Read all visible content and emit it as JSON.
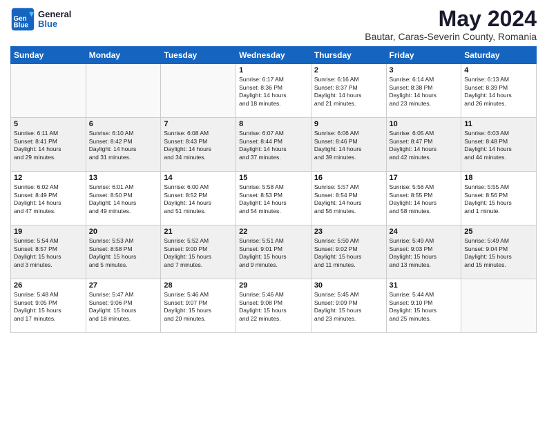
{
  "header": {
    "logo_line1": "General",
    "logo_line2": "Blue",
    "main_title": "May 2024",
    "subtitle": "Bautar, Caras-Severin County, Romania"
  },
  "days_of_week": [
    "Sunday",
    "Monday",
    "Tuesday",
    "Wednesday",
    "Thursday",
    "Friday",
    "Saturday"
  ],
  "weeks": [
    {
      "shade": "white",
      "days": [
        {
          "num": "",
          "info": ""
        },
        {
          "num": "",
          "info": ""
        },
        {
          "num": "",
          "info": ""
        },
        {
          "num": "1",
          "info": "Sunrise: 6:17 AM\nSunset: 8:36 PM\nDaylight: 14 hours\nand 18 minutes."
        },
        {
          "num": "2",
          "info": "Sunrise: 6:16 AM\nSunset: 8:37 PM\nDaylight: 14 hours\nand 21 minutes."
        },
        {
          "num": "3",
          "info": "Sunrise: 6:14 AM\nSunset: 8:38 PM\nDaylight: 14 hours\nand 23 minutes."
        },
        {
          "num": "4",
          "info": "Sunrise: 6:13 AM\nSunset: 8:39 PM\nDaylight: 14 hours\nand 26 minutes."
        }
      ]
    },
    {
      "shade": "shaded",
      "days": [
        {
          "num": "5",
          "info": "Sunrise: 6:11 AM\nSunset: 8:41 PM\nDaylight: 14 hours\nand 29 minutes."
        },
        {
          "num": "6",
          "info": "Sunrise: 6:10 AM\nSunset: 8:42 PM\nDaylight: 14 hours\nand 31 minutes."
        },
        {
          "num": "7",
          "info": "Sunrise: 6:08 AM\nSunset: 8:43 PM\nDaylight: 14 hours\nand 34 minutes."
        },
        {
          "num": "8",
          "info": "Sunrise: 6:07 AM\nSunset: 8:44 PM\nDaylight: 14 hours\nand 37 minutes."
        },
        {
          "num": "9",
          "info": "Sunrise: 6:06 AM\nSunset: 8:46 PM\nDaylight: 14 hours\nand 39 minutes."
        },
        {
          "num": "10",
          "info": "Sunrise: 6:05 AM\nSunset: 8:47 PM\nDaylight: 14 hours\nand 42 minutes."
        },
        {
          "num": "11",
          "info": "Sunrise: 6:03 AM\nSunset: 8:48 PM\nDaylight: 14 hours\nand 44 minutes."
        }
      ]
    },
    {
      "shade": "white",
      "days": [
        {
          "num": "12",
          "info": "Sunrise: 6:02 AM\nSunset: 8:49 PM\nDaylight: 14 hours\nand 47 minutes."
        },
        {
          "num": "13",
          "info": "Sunrise: 6:01 AM\nSunset: 8:50 PM\nDaylight: 14 hours\nand 49 minutes."
        },
        {
          "num": "14",
          "info": "Sunrise: 6:00 AM\nSunset: 8:52 PM\nDaylight: 14 hours\nand 51 minutes."
        },
        {
          "num": "15",
          "info": "Sunrise: 5:58 AM\nSunset: 8:53 PM\nDaylight: 14 hours\nand 54 minutes."
        },
        {
          "num": "16",
          "info": "Sunrise: 5:57 AM\nSunset: 8:54 PM\nDaylight: 14 hours\nand 56 minutes."
        },
        {
          "num": "17",
          "info": "Sunrise: 5:56 AM\nSunset: 8:55 PM\nDaylight: 14 hours\nand 58 minutes."
        },
        {
          "num": "18",
          "info": "Sunrise: 5:55 AM\nSunset: 8:56 PM\nDaylight: 15 hours\nand 1 minute."
        }
      ]
    },
    {
      "shade": "shaded",
      "days": [
        {
          "num": "19",
          "info": "Sunrise: 5:54 AM\nSunset: 8:57 PM\nDaylight: 15 hours\nand 3 minutes."
        },
        {
          "num": "20",
          "info": "Sunrise: 5:53 AM\nSunset: 8:58 PM\nDaylight: 15 hours\nand 5 minutes."
        },
        {
          "num": "21",
          "info": "Sunrise: 5:52 AM\nSunset: 9:00 PM\nDaylight: 15 hours\nand 7 minutes."
        },
        {
          "num": "22",
          "info": "Sunrise: 5:51 AM\nSunset: 9:01 PM\nDaylight: 15 hours\nand 9 minutes."
        },
        {
          "num": "23",
          "info": "Sunrise: 5:50 AM\nSunset: 9:02 PM\nDaylight: 15 hours\nand 11 minutes."
        },
        {
          "num": "24",
          "info": "Sunrise: 5:49 AM\nSunset: 9:03 PM\nDaylight: 15 hours\nand 13 minutes."
        },
        {
          "num": "25",
          "info": "Sunrise: 5:49 AM\nSunset: 9:04 PM\nDaylight: 15 hours\nand 15 minutes."
        }
      ]
    },
    {
      "shade": "white",
      "days": [
        {
          "num": "26",
          "info": "Sunrise: 5:48 AM\nSunset: 9:05 PM\nDaylight: 15 hours\nand 17 minutes."
        },
        {
          "num": "27",
          "info": "Sunrise: 5:47 AM\nSunset: 9:06 PM\nDaylight: 15 hours\nand 18 minutes."
        },
        {
          "num": "28",
          "info": "Sunrise: 5:46 AM\nSunset: 9:07 PM\nDaylight: 15 hours\nand 20 minutes."
        },
        {
          "num": "29",
          "info": "Sunrise: 5:46 AM\nSunset: 9:08 PM\nDaylight: 15 hours\nand 22 minutes."
        },
        {
          "num": "30",
          "info": "Sunrise: 5:45 AM\nSunset: 9:09 PM\nDaylight: 15 hours\nand 23 minutes."
        },
        {
          "num": "31",
          "info": "Sunrise: 5:44 AM\nSunset: 9:10 PM\nDaylight: 15 hours\nand 25 minutes."
        },
        {
          "num": "",
          "info": ""
        }
      ]
    }
  ]
}
